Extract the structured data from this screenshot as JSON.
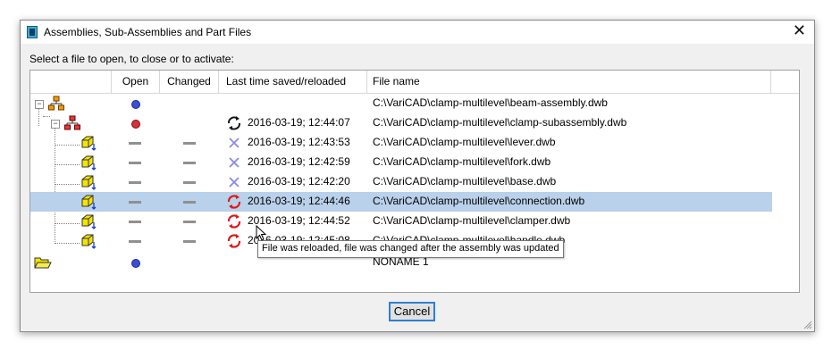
{
  "window": {
    "title": "Assemblies, Sub-Assemblies and Part Files",
    "close_glyph": "✕"
  },
  "prompt": "Select a file to open, to close or to activate:",
  "columns": [
    "Open",
    "Changed",
    "Last time saved/reloaded",
    "File name"
  ],
  "rows": [
    {
      "icon": "assembly-icon",
      "expander": "−",
      "open": "blue-dot",
      "changed": "",
      "status_icon": "",
      "saved": "",
      "file": "C:\\VariCAD\\clamp-multilevel\\beam-assembly.dwb"
    },
    {
      "icon": "subassembly-icon",
      "expander": "−",
      "open": "red-dot",
      "changed": "",
      "status_icon": "saved-sync-icon",
      "saved": "2016-03-19; 12:44:07",
      "file": "C:\\VariCAD\\clamp-multilevel\\clamp-subassembly.dwb"
    },
    {
      "icon": "part-icon",
      "expander": "",
      "open": "dash",
      "changed": "dash",
      "status_icon": "cross-icon",
      "saved": "2016-03-19; 12:43:53",
      "file": "C:\\VariCAD\\clamp-multilevel\\lever.dwb"
    },
    {
      "icon": "part-icon",
      "expander": "",
      "open": "dash",
      "changed": "dash",
      "status_icon": "cross-icon",
      "saved": "2016-03-19; 12:42:59",
      "file": "C:\\VariCAD\\clamp-multilevel\\fork.dwb"
    },
    {
      "icon": "part-icon",
      "expander": "",
      "open": "dash",
      "changed": "dash",
      "status_icon": "cross-icon",
      "saved": "2016-03-19; 12:42:20",
      "file": "C:\\VariCAD\\clamp-multilevel\\base.dwb"
    },
    {
      "icon": "part-icon",
      "expander": "",
      "open": "dash",
      "changed": "dash",
      "status_icon": "reloaded-icon",
      "saved": "2016-03-19; 12:44:46",
      "file": "C:\\VariCAD\\clamp-multilevel\\connection.dwb",
      "selected": true
    },
    {
      "icon": "part-icon",
      "expander": "",
      "open": "dash",
      "changed": "dash",
      "status_icon": "reloaded-icon",
      "saved": "2016-03-19; 12:44:52",
      "file": "C:\\VariCAD\\clamp-multilevel\\clamper.dwb"
    },
    {
      "icon": "part-icon",
      "expander": "",
      "open": "dash",
      "changed": "dash",
      "status_icon": "reloaded-icon",
      "saved": "2016-03-19; 12:45:08",
      "file": "C:\\VariCAD\\clamp-multilevel\\handle.dwb"
    },
    {
      "icon": "folder-icon",
      "expander": "",
      "open": "blue-dot",
      "changed": "",
      "status_icon": "",
      "saved": "",
      "file": "NONAME 1"
    }
  ],
  "tooltip": "File was reloaded, file was changed after the assembly was updated",
  "cancel_label": "Cancel",
  "colors": {
    "selection": "#b9d1ea",
    "blue_dot": "#3a4fd6",
    "red_dot": "#d9303a",
    "part_yellow": "#f5e400",
    "assembly_orange": "#f59b00",
    "accent_border": "#2f7fd0"
  }
}
